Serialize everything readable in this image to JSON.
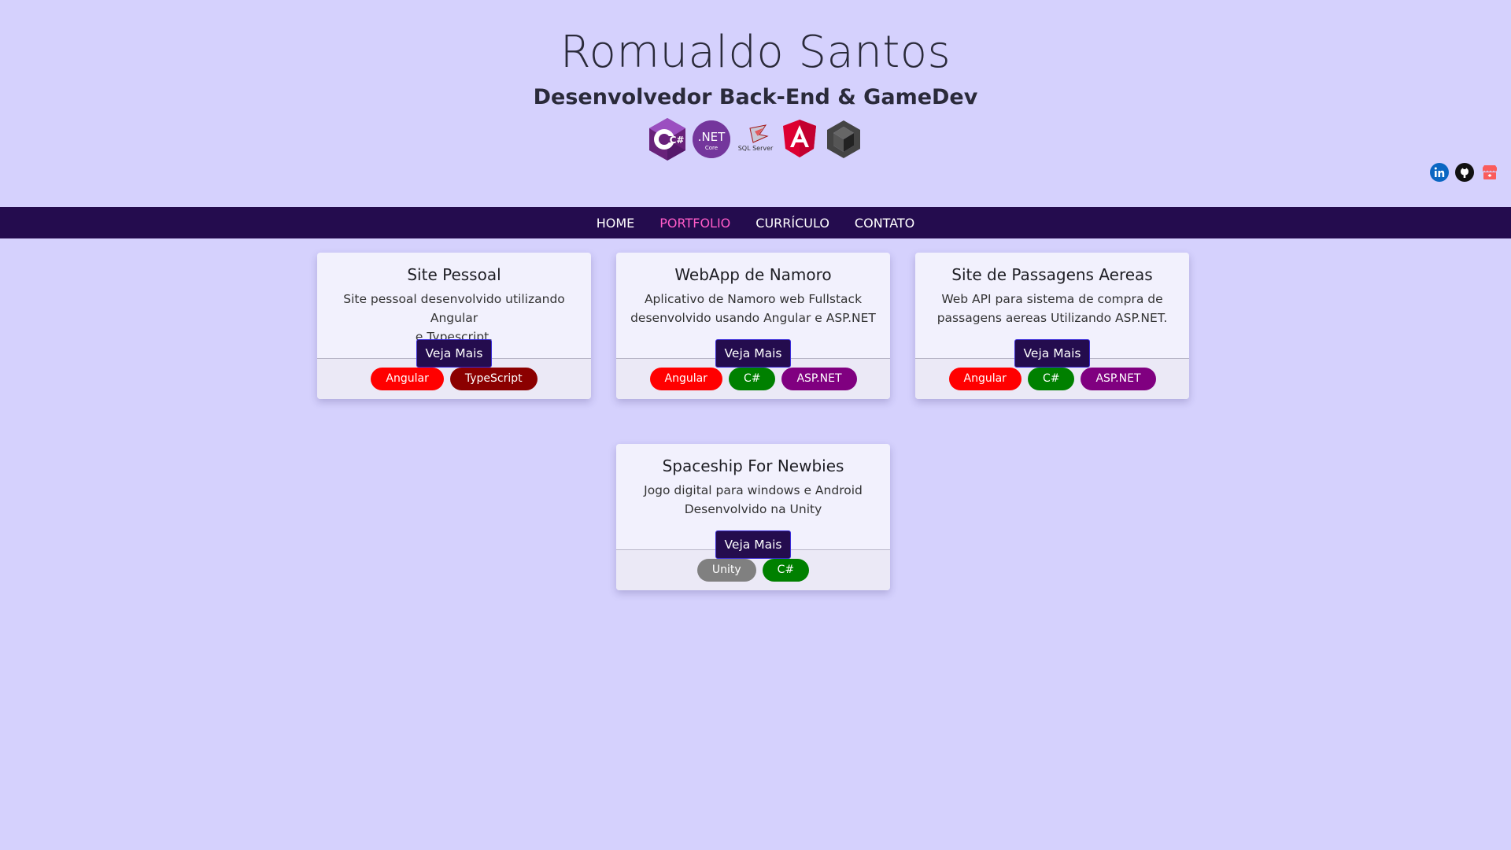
{
  "header": {
    "name": "Romualdo Santos",
    "subtitle": "Desenvolvedor Back-End & GameDev",
    "tech_icons": [
      "csharp-icon",
      "dotnet-core-icon",
      "sql-server-icon",
      "angular-icon",
      "unity-icon"
    ],
    "dotnet_label": ".NET",
    "dotnet_sub": "Core",
    "sql_label": "SQL Server",
    "csharp_label": "C#"
  },
  "social": [
    "linkedin-icon",
    "github-icon",
    "itchio-icon"
  ],
  "nav": {
    "items": [
      {
        "label": "HOME"
      },
      {
        "label": "PORTFOLIO",
        "active": true
      },
      {
        "label": "CURRÍCULO"
      },
      {
        "label": "CONTATO"
      }
    ],
    "bg_color": "#240c4e",
    "active_color": "#ff5cc8"
  },
  "colors": {
    "page_bg": "#d5d1fd",
    "angular": "#ff0000",
    "typescript": "#8b0000",
    "csharp": "#008000",
    "aspnet": "#800080",
    "unity": "#808080"
  },
  "cards": [
    {
      "title": "Site Pessoal",
      "desc_line1": "Site pessoal desenvolvido utilizando Angular",
      "desc_line2": "e Typescript.",
      "button": "Veja Mais",
      "tags": [
        "Angular",
        "TypeScript"
      ]
    },
    {
      "title": "WebApp de Namoro",
      "desc_line1": "Aplicativo de Namoro web Fullstack",
      "desc_line2": "desenvolvido usando Angular e ASP.NET",
      "button": "Veja Mais",
      "tags": [
        "Angular",
        "C#",
        "ASP.NET"
      ]
    },
    {
      "title": "Site de Passagens Aereas",
      "desc_line1": "Web API para sistema de compra de",
      "desc_line2": "passagens aereas Utilizando ASP.NET.",
      "button": "Veja Mais",
      "tags": [
        "Angular",
        "C#",
        "ASP.NET"
      ]
    },
    {
      "title": "Spaceship For Newbies",
      "desc_line1": "Jogo digital para windows e Android",
      "desc_line2": "Desenvolvido na Unity",
      "button": "Veja Mais",
      "tags": [
        "Unity",
        "C#"
      ]
    }
  ]
}
